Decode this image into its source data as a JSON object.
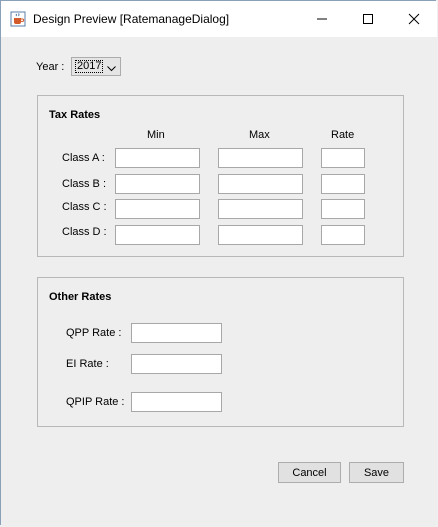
{
  "window": {
    "title": "Design Preview [RatemanageDialog]"
  },
  "year": {
    "label": "Year :",
    "selected": "2017"
  },
  "tax_rates": {
    "title": "Tax Rates",
    "columns": {
      "min": "Min",
      "max": "Max",
      "rate": "Rate"
    },
    "rows": [
      {
        "label": "Class A :",
        "min": "",
        "max": "",
        "rate": ""
      },
      {
        "label": "Class B :",
        "min": "",
        "max": "",
        "rate": ""
      },
      {
        "label": "Class C :",
        "min": "",
        "max": "",
        "rate": ""
      },
      {
        "label": "Class D :",
        "min": "",
        "max": "",
        "rate": ""
      }
    ]
  },
  "other_rates": {
    "title": "Other Rates",
    "rows": [
      {
        "label": "QPP Rate :",
        "value": ""
      },
      {
        "label": "EI Rate :",
        "value": ""
      },
      {
        "label": "QPIP Rate :",
        "value": ""
      }
    ]
  },
  "buttons": {
    "cancel": "Cancel",
    "save": "Save"
  },
  "icons": {
    "app": "java-cup-icon",
    "minimize": "minimize-icon",
    "maximize": "maximize-icon",
    "close": "close-icon",
    "dropdown": "chevron-down-icon"
  }
}
